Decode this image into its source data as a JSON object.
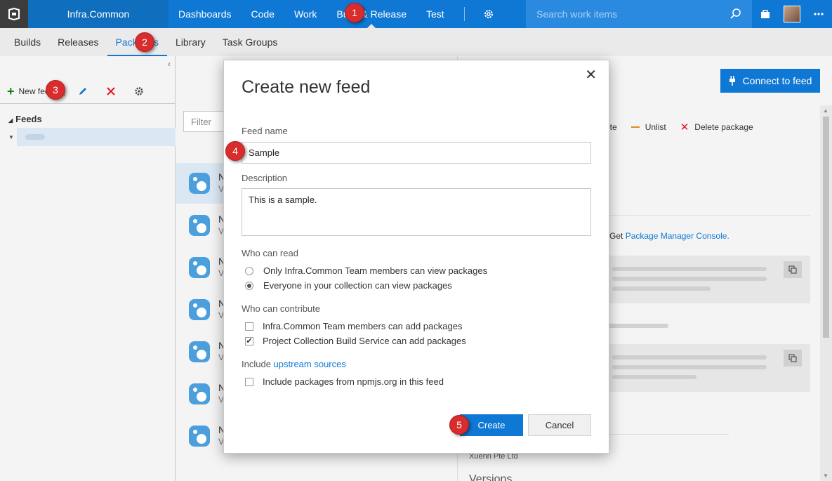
{
  "topnav": {
    "project": "Infra.Common",
    "links": [
      "Dashboards",
      "Code",
      "Work",
      "Build & Release",
      "Test"
    ],
    "search_placeholder": "Search work items"
  },
  "subnav": {
    "tabs": [
      "Builds",
      "Releases",
      "Packages",
      "Library",
      "Task Groups"
    ]
  },
  "left": {
    "new_feed": "New feed",
    "feeds_heading": "Feeds"
  },
  "middle": {
    "filter_placeholder": "Filter",
    "packages": [
      {
        "name": "N",
        "ver": "V"
      },
      {
        "name": "N",
        "ver": "V"
      },
      {
        "name": "N",
        "ver": "V"
      },
      {
        "name": "N",
        "ver": "V"
      },
      {
        "name": "N",
        "ver": "V"
      },
      {
        "name": "N",
        "ver": "V"
      },
      {
        "name": "N",
        "ver": "V"
      }
    ]
  },
  "right": {
    "connect": "Connect to feed",
    "promote": "mote",
    "unlist": "Unlist",
    "delete": "Delete package",
    "console_prefix": "Get ",
    "console_link": "Package Manager Console.",
    "company": "Xuenn Pte Ltd",
    "versions": "Versions"
  },
  "dialog": {
    "title": "Create new feed",
    "feed_name_label": "Feed name",
    "feed_name_value": "Sample",
    "description_label": "Description",
    "description_value": "This is a sample.",
    "who_read_label": "Who can read",
    "read_options": [
      {
        "label": "Only Infra.Common Team members can view packages",
        "selected": false
      },
      {
        "label": "Everyone in your collection can view packages",
        "selected": true
      }
    ],
    "who_contribute_label": "Who can contribute",
    "contribute_options": [
      {
        "label": "Infra.Common Team members can add packages",
        "checked": false
      },
      {
        "label": "Project Collection Build Service can add packages",
        "checked": true
      }
    ],
    "include_prefix": "Include ",
    "include_link": "upstream sources",
    "upstream_option": "Include packages from npmjs.org in this feed",
    "create": "Create",
    "cancel": "Cancel"
  },
  "badges": [
    "1",
    "2",
    "3",
    "4",
    "5"
  ],
  "colors": {
    "accent": "#0f78d4",
    "badge": "#d92c2c"
  }
}
